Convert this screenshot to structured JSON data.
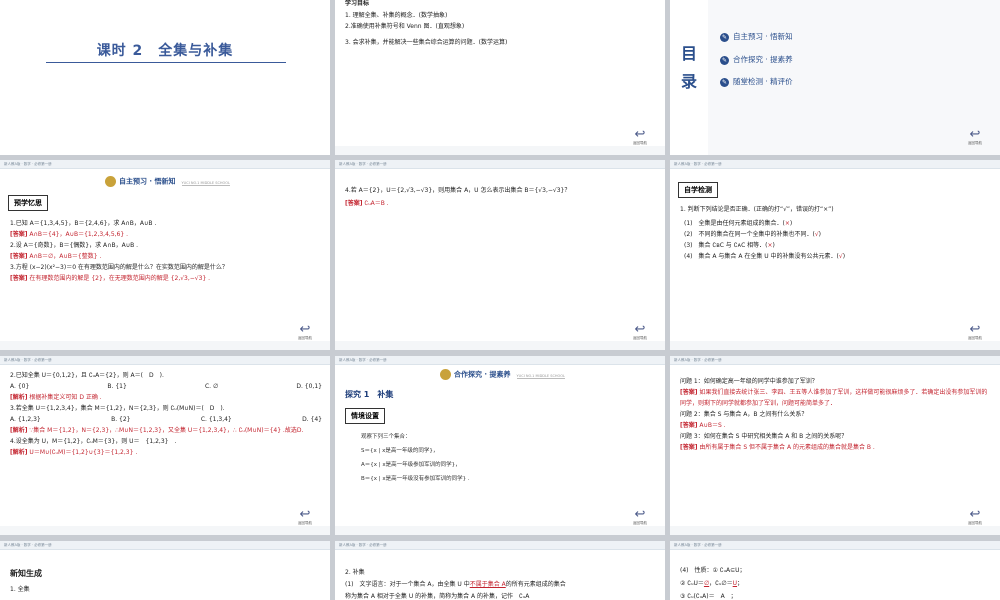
{
  "common": {
    "topbar": "新人教A版 · 数学 · 必修第一册",
    "back_label": "返回导航",
    "school_tag": "YUCI NO.1 MIDDLE SCHOOL"
  },
  "s1": {
    "title": "课时 2　全集与补集"
  },
  "s2": {
    "heading": "学习目标",
    "items": [
      "1. 理解全集、补集的概念．(数学抽象)",
      "2.准确使用补集符号和 Venn 图．(直观想象)",
      "3. 会求补集，并能解决一些集合综合运算的问题．(数学运算)"
    ]
  },
  "s3": {
    "mulu": [
      "目",
      "录"
    ],
    "items": [
      "自主预习 · 悟新知",
      "合作探究 · 提素养",
      "随堂检测 · 精评价"
    ]
  },
  "s4": {
    "header": "自主预习 · 悟新知",
    "box": "预学忆思",
    "lines": [
      {
        "t": "q",
        "v": "1.已知 A＝{1,3,4,5}，B＝{2,4,6}，求 A∩B，A∪B ."
      },
      {
        "t": "a",
        "tag": "[答案]",
        "v": "A∩B＝{4}，A∪B＝{1,2,3,4,5,6} ."
      },
      {
        "t": "q",
        "v": "2.设 A＝{奇数}，B＝{偶数}，求 A∩B，A∪B ."
      },
      {
        "t": "a",
        "tag": "[答案]",
        "v": "A∩B＝∅，A∪B＝{整数} ."
      },
      {
        "t": "q",
        "v": "3.方程 (x−2)(x²−3)＝0 在有理数范围内的解是什么？在实数范围内的解是什么？"
      },
      {
        "t": "a",
        "tag": "[答案]",
        "v": "在有理数范围内的解是 {2}，在无理数范围内的解是 {2,√3,−√3} ."
      }
    ]
  },
  "s5": {
    "q": "4.若 A＝{2}，U＝{2,√3,−√3}，则用集合 A，U 怎么表示出集合 B＝{√3,−√3}？",
    "tag": "[答案]",
    "a": "∁ᵤA＝B ."
  },
  "s6": {
    "box": "自学检测",
    "intro": "1. 判断下列结论是否正确．(正确的打“√”，错误的打“×”)",
    "items": [
      {
        "q": "(1)　全集是由任何元素组成的集合．(",
        "m": "×",
        "e": ")"
      },
      {
        "q": "(2)　不同的集合在同一个全集中的补集也不同．(",
        "m": "√",
        "e": ")"
      },
      {
        "q": "(3)　集合 ∁ʙC 与 ∁ᴀC 相等．(",
        "m": "×",
        "e": ")"
      },
      {
        "q": "(4)　集合 A 与集合 A 在全集 U 中的补集没有公共元素．(",
        "m": "√",
        "e": ")"
      }
    ]
  },
  "s7": {
    "lines": [
      {
        "t": "q",
        "v": "2.已知全集 U＝{0,1,2}，且 ∁ᵤA＝{2}，则 A＝(　D　)."
      },
      {
        "t": "opts",
        "v": [
          "A. {0}",
          "B. {1}",
          "C. ∅",
          "D. {0,1}"
        ]
      },
      {
        "t": "a",
        "tag": "[解析]",
        "v": "根据补集定义可知 D 正确 ."
      },
      {
        "t": "q",
        "v": "3.若全集 U＝{1,2,3,4}，集合 M＝{1,2}，N＝{2,3}，则 ∁ᵤ(M∪N)＝(　D　)."
      },
      {
        "t": "opts",
        "v": [
          "A. {1,2,3}",
          "B. {2}",
          "C. {1,3,4}",
          "D. {4}"
        ]
      },
      {
        "t": "a",
        "tag": "[解析]",
        "v": "∵集合 M＝{1,2}，N＝{2,3}，∴M∪N＝{1,2,3}，又全集 U＝{1,2,3,4}，∴ ∁ᵤ(M∪N)＝{4} .故选D."
      },
      {
        "t": "q",
        "v": "4.设全集为 U，M＝{1,2}，∁ᵤM＝{3}，则 U＝　{1,2,3}　."
      },
      {
        "t": "a",
        "tag": "[解析]",
        "v": "U＝M∪(∁ᵤM)＝{1,2}∪{3}＝{1,2,3} ."
      }
    ]
  },
  "s8": {
    "header": "合作探究 · 提素养",
    "section": "探究 1　补集",
    "box": "情境设置",
    "lines": [
      "观察下列三个集合：",
      "S＝{x | x是高一年级的同学}，",
      "A＝{x | x是高一年级参加军训的同学}，",
      "B＝{x | x是高一年级没有参加军训的同学} ."
    ]
  },
  "s9": {
    "lines": [
      {
        "t": "q",
        "v": "问题 1：如何确定高一年级的同学中谁参加了军训？"
      },
      {
        "t": "a",
        "tag": "[答案]",
        "v": "如果我们直接去统计张三、李四、王五等人谁参加了军训，这样做可能很麻烦多了．若确定出没有参加军训的同学，则剩下的同学就都参加了军训，问题可能简单多了．"
      },
      {
        "t": "q",
        "v": "问题 2：集合 S 与集合 A，B 之间有什么关系？"
      },
      {
        "t": "a",
        "tag": "[答案]",
        "v": "A∪B＝S ."
      },
      {
        "t": "q",
        "v": "问题 3：如何在集合 S 中研究相关集合 A 和 B 之间的关系呢？"
      },
      {
        "t": "a",
        "tag": "[答案]",
        "v": "由所有属于集合 S 但不属于集合 A 的元素组成的集合就是集合 B ."
      }
    ]
  },
  "s10": {
    "title": "新知生成",
    "item": "1. 全集"
  },
  "s11": {
    "head": "2. 补集",
    "l1a": "(1)　文字语言：对于一个集合 A，由全集 U 中",
    "l1b": "不属于集合 A",
    "l1c": "的所有元素组成的集合",
    "l2": "称为集合 A 相对于全集 U 的补集，简称为集合 A 的补集，记作　∁ᵤA"
  },
  "s12": {
    "l1": "(4)　性质：① ∁ᵤA⊆U；",
    "l2a": "② ∁ᵤU＝",
    "l2b": "∅",
    "l2c": "，∁ᵤ∅＝",
    "l2d": "U",
    "l2e": "；",
    "l3": "③ ∁ᵤ(∁ᵤA)＝　A　；"
  }
}
